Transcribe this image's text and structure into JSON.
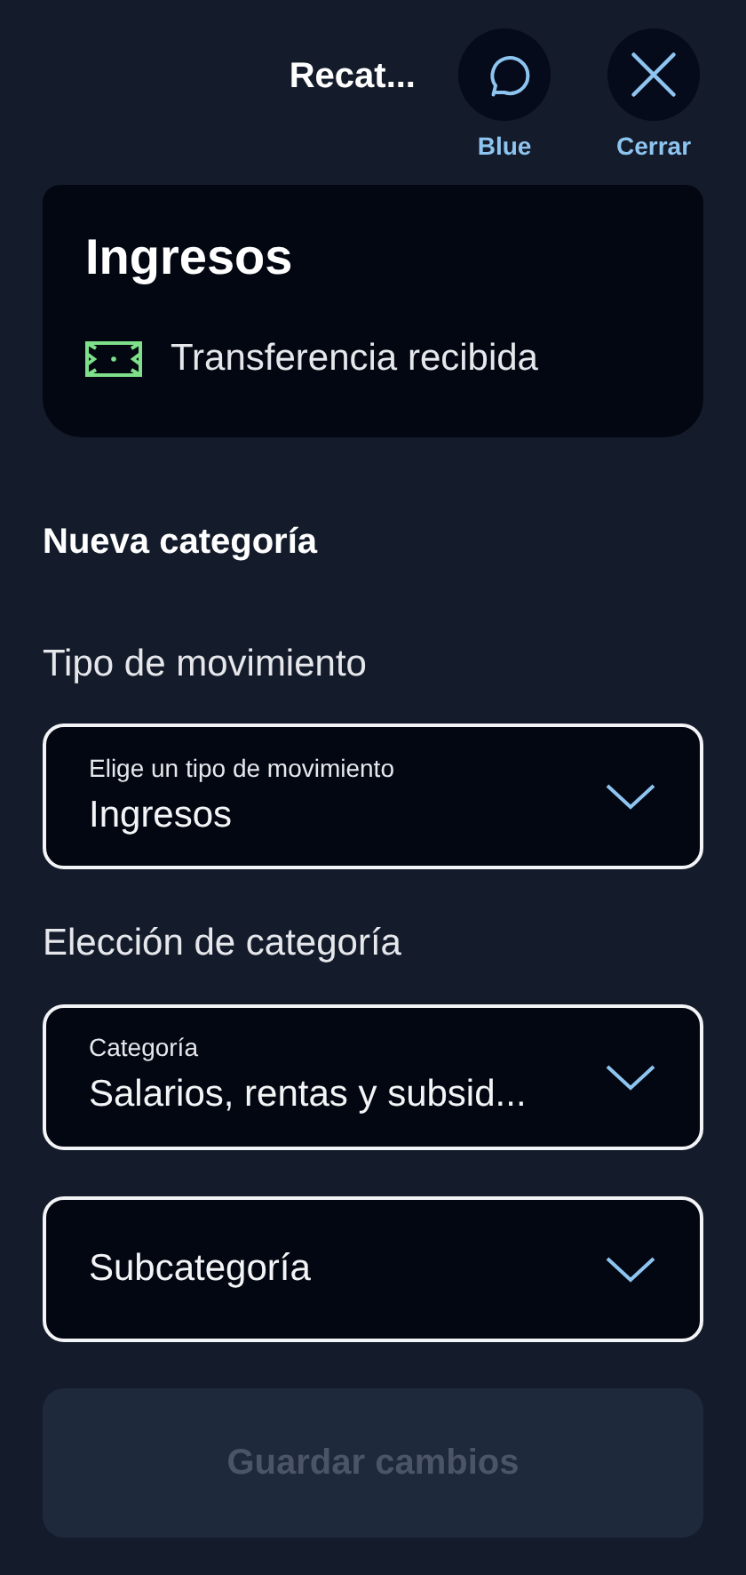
{
  "header": {
    "title": "Recat...",
    "actions": [
      {
        "kind": "chat",
        "label": "Blue"
      },
      {
        "kind": "close",
        "label": "Cerrar"
      }
    ]
  },
  "card": {
    "title": "Ingresos",
    "subtitle": "Transferencia recibida"
  },
  "section_title": "Nueva categoría",
  "groups": [
    {
      "label": "Tipo de movimiento",
      "selects": [
        {
          "label": "Elige un tipo de movimiento",
          "value": "Ingresos"
        }
      ]
    },
    {
      "label": "Elección de categoría",
      "selects": [
        {
          "label": "Categoría",
          "value": "Salarios, rentas y subsid..."
        },
        {
          "placeholder": "Subcategoría"
        }
      ]
    }
  ],
  "save_button": {
    "label": "Guardar cambios",
    "disabled": true
  }
}
